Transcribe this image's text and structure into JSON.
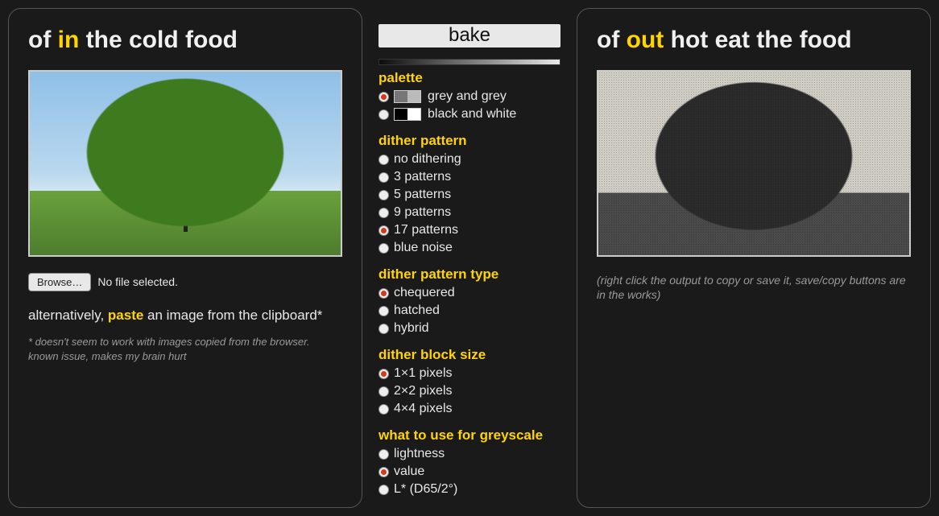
{
  "left": {
    "title_pre": "of ",
    "title_hl": "in",
    "title_post": " the cold food",
    "browse_label": "Browse…",
    "file_status": "No file selected.",
    "alt_pre": "alternatively, ",
    "alt_hl": "paste",
    "alt_post": " an image from the clipboard*",
    "footnote": "* doesn't seem to work with images copied from the browser. known issue, makes my brain hurt"
  },
  "mid": {
    "bake_label": "bake",
    "groups": {
      "palette": {
        "title": "palette",
        "opts": [
          {
            "label": "grey and grey",
            "selected": true,
            "sw": [
              "#777",
              "#bbb"
            ]
          },
          {
            "label": "black and white",
            "selected": false,
            "sw": [
              "#000",
              "#fff"
            ]
          }
        ]
      },
      "dither_pattern": {
        "title": "dither pattern",
        "opts": [
          {
            "label": "no dithering",
            "selected": false
          },
          {
            "label": "3 patterns",
            "selected": false
          },
          {
            "label": "5 patterns",
            "selected": false
          },
          {
            "label": "9 patterns",
            "selected": false
          },
          {
            "label": "17 patterns",
            "selected": true
          },
          {
            "label": "blue noise",
            "selected": false
          }
        ]
      },
      "dither_pattern_type": {
        "title": "dither pattern type",
        "opts": [
          {
            "label": "chequered",
            "selected": true
          },
          {
            "label": "hatched",
            "selected": false
          },
          {
            "label": "hybrid",
            "selected": false
          }
        ]
      },
      "dither_block_size": {
        "title": "dither block size",
        "opts": [
          {
            "label": "1×1 pixels",
            "selected": true
          },
          {
            "label": "2×2 pixels",
            "selected": false
          },
          {
            "label": "4×4 pixels",
            "selected": false
          }
        ]
      },
      "greyscale": {
        "title": "what to use for greyscale",
        "opts": [
          {
            "label": "lightness",
            "selected": false
          },
          {
            "label": "value",
            "selected": true
          },
          {
            "label": "L* (D65/2°)",
            "selected": false
          }
        ]
      }
    }
  },
  "right": {
    "title_pre": "of ",
    "title_hl": "out",
    "title_post": " hot eat the food",
    "hint": "(right click the output to copy or save it, save/copy buttons are in the works)"
  }
}
